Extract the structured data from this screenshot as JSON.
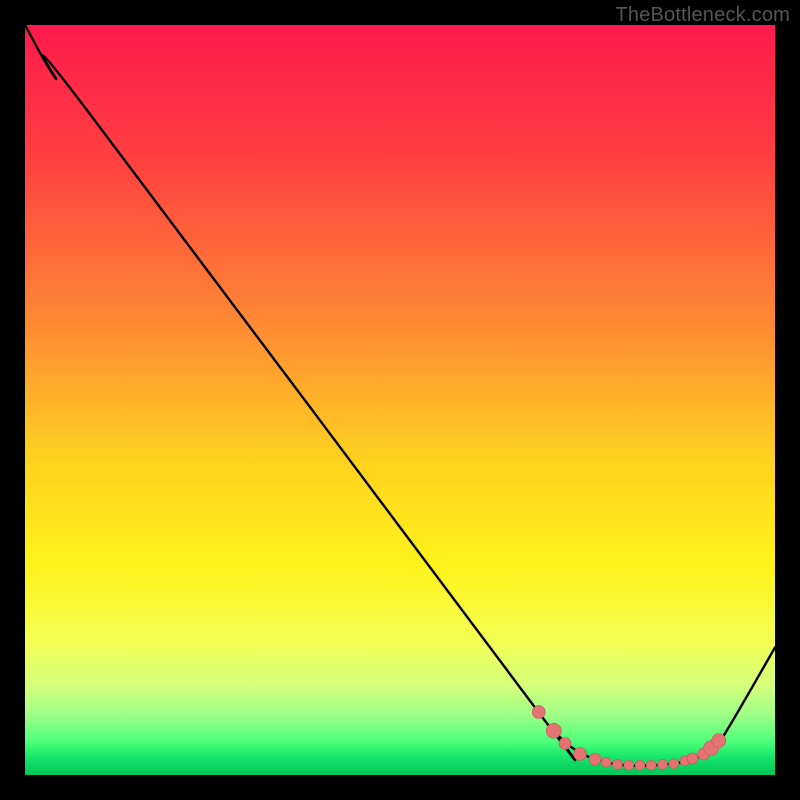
{
  "attribution": "TheBottleneck.com",
  "colors": {
    "black": "#000000",
    "curve": "#000000",
    "marker_fill": "#e57373",
    "marker_stroke": "#c05656",
    "attribution_text": "#555555"
  },
  "chart_data": {
    "type": "line",
    "title": "",
    "xlabel": "",
    "ylabel": "",
    "xlim": [
      0,
      100
    ],
    "ylim": [
      0,
      100
    ],
    "gradient_stops": [
      {
        "offset": 0,
        "color": "#ff1a4d"
      },
      {
        "offset": 0.18,
        "color": "#ff4040"
      },
      {
        "offset": 0.4,
        "color": "#ff8a33"
      },
      {
        "offset": 0.58,
        "color": "#ffd21f"
      },
      {
        "offset": 0.72,
        "color": "#fff21a"
      },
      {
        "offset": 0.82,
        "color": "#f4ff52"
      },
      {
        "offset": 0.88,
        "color": "#d5ff7a"
      },
      {
        "offset": 0.92,
        "color": "#9dff86"
      },
      {
        "offset": 0.955,
        "color": "#4dff7a"
      },
      {
        "offset": 0.975,
        "color": "#18e86a"
      },
      {
        "offset": 1.0,
        "color": "#00c558"
      }
    ],
    "series": [
      {
        "name": "bottleneck-curve",
        "x": [
          0,
          4,
          8,
          68,
          71,
          73,
          76,
          80,
          84,
          88,
          91,
          93,
          100
        ],
        "y": [
          100,
          93,
          89,
          9.0,
          5.4,
          3.6,
          2.1,
          1.3,
          1.3,
          1.8,
          3.0,
          5.0,
          17
        ]
      }
    ],
    "markers": {
      "name": "highlight-points",
      "x": [
        68.5,
        70.5,
        72.0,
        74.0,
        76.0,
        77.5,
        79.0,
        80.5,
        82.0,
        83.5,
        85.0,
        86.5,
        88.0,
        89.0,
        90.5,
        91.5,
        92.5
      ],
      "y": [
        8.4,
        5.9,
        4.2,
        2.8,
        2.1,
        1.7,
        1.4,
        1.3,
        1.3,
        1.3,
        1.4,
        1.5,
        1.9,
        2.2,
        2.8,
        3.6,
        4.6
      ],
      "r": [
        6.5,
        7.5,
        6.0,
        6.5,
        6.0,
        5.0,
        5.0,
        5.0,
        5.0,
        5.0,
        5.0,
        5.0,
        5.0,
        5.5,
        6.0,
        7.5,
        7.0
      ]
    }
  }
}
